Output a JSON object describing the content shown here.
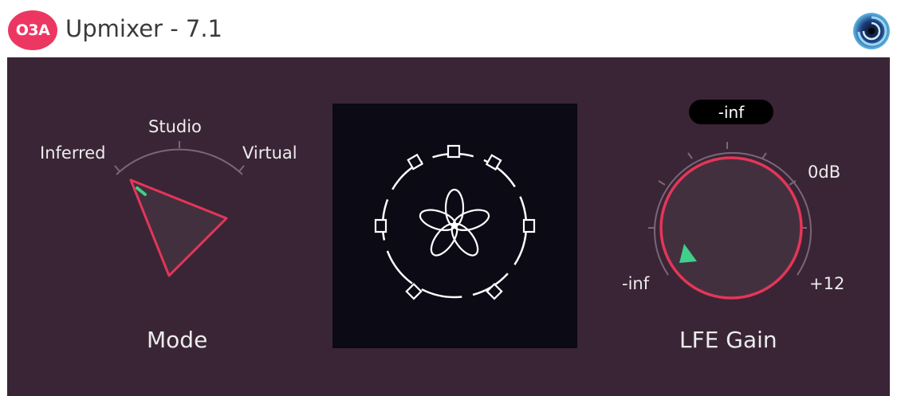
{
  "header": {
    "badge": "O3A",
    "title": "Upmixer - 7.1",
    "logo_icon": "swirl-logo-icon"
  },
  "mode": {
    "label": "Mode",
    "options": [
      "Inferred",
      "Studio",
      "Virtual"
    ],
    "selected": "Inferred"
  },
  "display": {
    "speaker_icon": "speaker-square-icon",
    "center_icon": "flower-icon"
  },
  "lfe": {
    "label": "LFE Gain",
    "value": "-inf",
    "scale_min": "-inf",
    "scale_mid": "0dB",
    "scale_max": "+12"
  },
  "colors": {
    "panel": "#3a2536",
    "accent": "#e43658",
    "indicator": "#3fd08a",
    "badge": "#ec3763"
  }
}
